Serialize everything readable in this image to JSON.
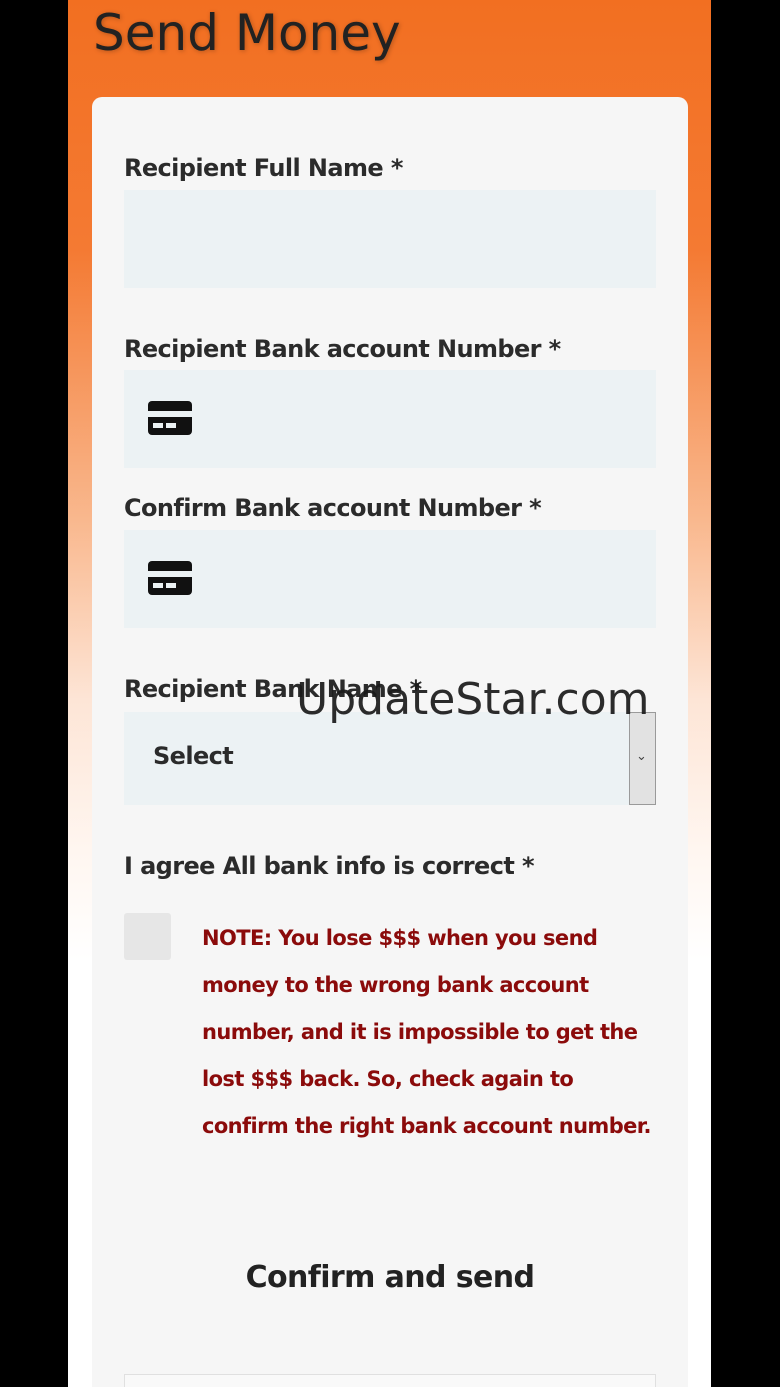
{
  "header": {
    "title": "Send Money"
  },
  "form": {
    "recipient_name": {
      "label": "Recipient Full Name *",
      "value": ""
    },
    "account_number": {
      "label": "Recipient Bank account Number *",
      "value": "",
      "icon": "credit-card-icon"
    },
    "confirm_account_number": {
      "label": "Confirm Bank account Number *",
      "value": "",
      "icon": "credit-card-icon"
    },
    "bank_name": {
      "label": "Recipient Bank Name *",
      "selected": "Select",
      "icon": "chevron-down-icon"
    },
    "agree": {
      "label": "I agree All bank info is correct *",
      "checked": false,
      "note": "NOTE: You lose $$$ when you send money to the wrong bank account number, and it is impossible to get the lost $$$ back. So, check again to confirm the right bank account number."
    },
    "submit_label": "Confirm and send"
  },
  "watermark": "UpdateStar.com",
  "colors": {
    "header_orange": "#f26f21",
    "note_red": "#8b0b0b",
    "input_bg": "#ecf2f4",
    "card_bg": "#f6f6f6"
  }
}
